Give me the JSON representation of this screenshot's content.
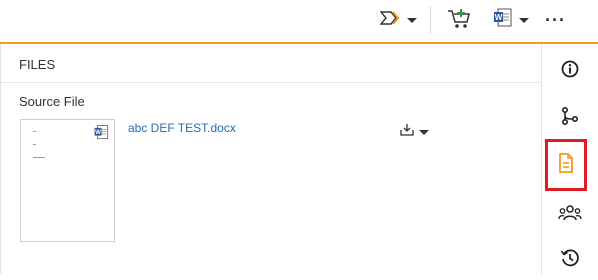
{
  "toolbar": {
    "workflow_icon": "workflow-arrows-icon",
    "cart_icon": "add-to-cart-icon",
    "word_icon": "word-document-icon",
    "more_label": "···"
  },
  "panel": {
    "title": "FILES",
    "source_label": "Source File",
    "file": {
      "name": "abc DEF TEST.docx",
      "type_icon": "word-document-icon",
      "download_icon": "download-icon"
    }
  },
  "sidebar": {
    "items": [
      {
        "name": "info",
        "icon": "info-icon"
      },
      {
        "name": "workflow",
        "icon": "branch-icon"
      },
      {
        "name": "files",
        "icon": "document-icon",
        "active": true
      },
      {
        "name": "users",
        "icon": "users-group-icon"
      },
      {
        "name": "history",
        "icon": "history-icon"
      }
    ]
  },
  "colors": {
    "accent": "#f59a1a",
    "link": "#1f6fb5",
    "highlight_border": "#e01b24"
  }
}
